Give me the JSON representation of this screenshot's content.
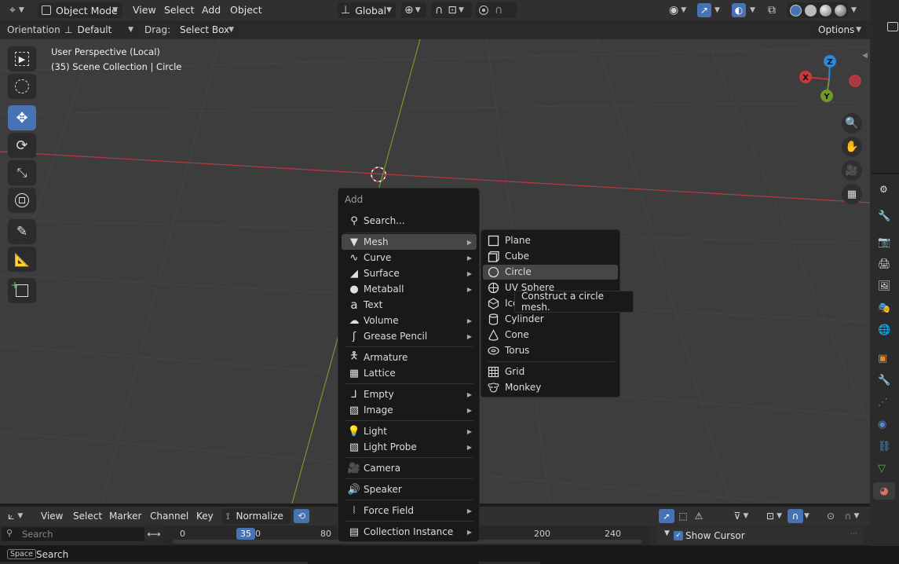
{
  "header": {
    "mode": "Object Mode",
    "menus": [
      "View",
      "Select",
      "Add",
      "Object"
    ],
    "transform_orientation": "Global"
  },
  "toolsettings": {
    "orientation_label": "Orientation:",
    "orientation_value": "Default",
    "drag_label": "Drag:",
    "drag_value": "Select Box",
    "options_label": "Options"
  },
  "viewport": {
    "perspective": "User Perspective (Local)",
    "collection": "(35) Scene Collection | Circle",
    "gizmo": {
      "x": "X",
      "y": "Y",
      "z": "Z"
    }
  },
  "add_menu": {
    "title": "Add",
    "search": "Search...",
    "items": [
      {
        "label": "Mesh",
        "icon": "mesh-icon",
        "submenu": true
      },
      {
        "label": "Curve",
        "icon": "curve-icon",
        "submenu": true
      },
      {
        "label": "Surface",
        "icon": "surface-icon",
        "submenu": true
      },
      {
        "label": "Metaball",
        "icon": "metaball-icon",
        "submenu": true
      },
      {
        "label": "Text",
        "icon": "text-icon",
        "submenu": false
      },
      {
        "label": "Volume",
        "icon": "volume-icon",
        "submenu": true
      },
      {
        "label": "Grease Pencil",
        "icon": "grease-pencil-icon",
        "submenu": true
      },
      {
        "label": "Armature",
        "icon": "armature-icon",
        "submenu": false
      },
      {
        "label": "Lattice",
        "icon": "lattice-icon",
        "submenu": false
      },
      {
        "label": "Empty",
        "icon": "empty-icon",
        "submenu": true
      },
      {
        "label": "Image",
        "icon": "image-icon",
        "submenu": true
      },
      {
        "label": "Light",
        "icon": "light-icon",
        "submenu": true
      },
      {
        "label": "Light Probe",
        "icon": "light-probe-icon",
        "submenu": true
      },
      {
        "label": "Camera",
        "icon": "camera-icon",
        "submenu": false
      },
      {
        "label": "Speaker",
        "icon": "speaker-icon",
        "submenu": false
      },
      {
        "label": "Force Field",
        "icon": "force-field-icon",
        "submenu": true
      },
      {
        "label": "Collection Instance",
        "icon": "collection-instance-icon",
        "submenu": true
      }
    ]
  },
  "mesh_menu": {
    "items": [
      {
        "label": "Plane",
        "icon": "plane-icon"
      },
      {
        "label": "Cube",
        "icon": "cube-icon"
      },
      {
        "label": "Circle",
        "icon": "circle-icon"
      },
      {
        "label": "UV Sphere",
        "icon": "uv-sphere-icon"
      },
      {
        "label": "Ico Sphere",
        "icon": "ico-sphere-icon"
      },
      {
        "label": "Cylinder",
        "icon": "cylinder-icon"
      },
      {
        "label": "Cone",
        "icon": "cone-icon"
      },
      {
        "label": "Torus",
        "icon": "torus-icon"
      },
      {
        "label": "Grid",
        "icon": "grid-icon"
      },
      {
        "label": "Monkey",
        "icon": "monkey-icon"
      }
    ],
    "highlighted": "Circle"
  },
  "tooltip": {
    "text": "Construct a circle mesh."
  },
  "timeline": {
    "menus": [
      "View",
      "Select",
      "Marker",
      "Channel",
      "Key"
    ],
    "normalize_label": "Normalize",
    "search_placeholder": "Search",
    "current_frame": "35",
    "ticks": [
      "0",
      "0",
      "80",
      "200",
      "240"
    ],
    "show_cursor_label": "Show Cursor"
  },
  "statusbar": {
    "key": "Space",
    "action": "Search"
  },
  "colors": {
    "accent": "#4772b3",
    "x_axis": "#c8393f",
    "y_axis": "#6e9a2b",
    "z_axis": "#2f86d8"
  }
}
